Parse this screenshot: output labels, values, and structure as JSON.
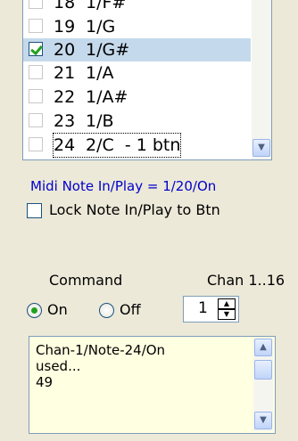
{
  "note_list": {
    "items": [
      {
        "num": "18",
        "note": "1/F#",
        "suffix": "",
        "checked": false,
        "selected": false,
        "focused": false
      },
      {
        "num": "19",
        "note": "1/G",
        "suffix": "",
        "checked": false,
        "selected": false,
        "focused": false
      },
      {
        "num": "20",
        "note": "1/G#",
        "suffix": "",
        "checked": true,
        "selected": true,
        "focused": false
      },
      {
        "num": "21",
        "note": "1/A",
        "suffix": "",
        "checked": false,
        "selected": false,
        "focused": false
      },
      {
        "num": "22",
        "note": "1/A#",
        "suffix": "",
        "checked": false,
        "selected": false,
        "focused": false
      },
      {
        "num": "23",
        "note": "1/B",
        "suffix": "",
        "checked": false,
        "selected": false,
        "focused": false
      },
      {
        "num": "24",
        "note": "2/C",
        "suffix": "  - 1 btn",
        "checked": false,
        "selected": false,
        "focused": true
      }
    ]
  },
  "midi_status": "Midi Note In/Play = 1/20/On",
  "lock": {
    "label": "Lock Note In/Play to Btn",
    "checked": false
  },
  "command": {
    "label": "Command",
    "options": [
      {
        "label": "On",
        "selected": true
      },
      {
        "label": "Off",
        "selected": false
      }
    ]
  },
  "channel": {
    "label": "Chan 1..16",
    "value": "1"
  },
  "log": {
    "lines": [
      "Chan-1/Note-24/On",
      "used...",
      "49"
    ]
  },
  "colors": {
    "status_text": "#0000cc",
    "check_green": "#21a121",
    "selection": "#c5d9ec",
    "log_background": "#ffffe1"
  }
}
